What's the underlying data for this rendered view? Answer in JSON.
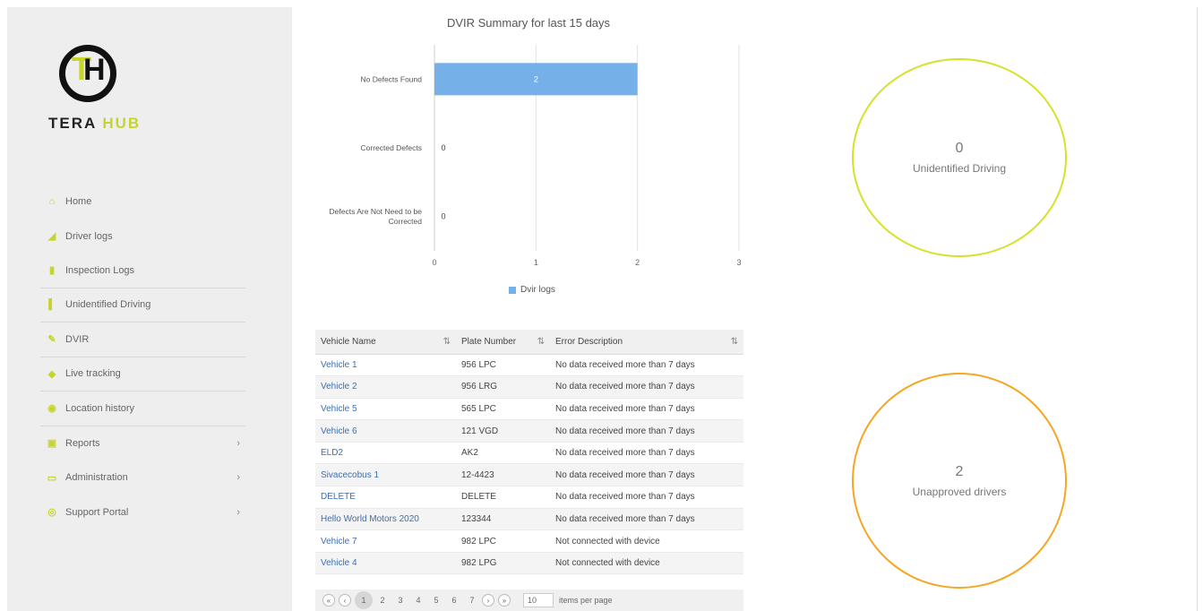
{
  "brand": {
    "name_part1": "TERA ",
    "name_part2": "HUB",
    "mark_t": "T",
    "mark_h": "H",
    "accent_color": "#c7d42d"
  },
  "sidebar": {
    "items": [
      {
        "label": "Home",
        "icon": "home-icon",
        "glyph": "⌂",
        "caret": ""
      },
      {
        "label": "Driver logs",
        "icon": "chart-icon",
        "glyph": "◢",
        "caret": ""
      },
      {
        "label": "Inspection Logs",
        "icon": "inspection-icon",
        "glyph": "▮",
        "caret": ""
      },
      {
        "label": "Unidentified Driving",
        "icon": "unidentified-icon",
        "glyph": "▌",
        "caret": ""
      },
      {
        "label": "DVIR",
        "icon": "wrench-icon",
        "glyph": "✎",
        "caret": ""
      },
      {
        "label": "Live tracking",
        "icon": "tracking-icon",
        "glyph": "◆",
        "caret": ""
      },
      {
        "label": "Location history",
        "icon": "history-icon",
        "glyph": "◉",
        "caret": ""
      },
      {
        "label": "Reports",
        "icon": "reports-icon",
        "glyph": "▣",
        "caret": "›"
      },
      {
        "label": "Administration",
        "icon": "admin-icon",
        "glyph": "▭",
        "caret": "›"
      },
      {
        "label": "Support Portal",
        "icon": "support-icon",
        "glyph": "◎",
        "caret": "›"
      }
    ]
  },
  "chart": {
    "title": "DVIR Summary for last 15 days",
    "legend": "Dvir logs"
  },
  "chart_data": {
    "type": "bar",
    "orientation": "horizontal",
    "title": "DVIR Summary for last 15 days",
    "categories": [
      "No Defects Found",
      "Corrected Defects",
      "Defects Are Not Need to be Corrected"
    ],
    "series": [
      {
        "name": "Dvir logs",
        "values": [
          2,
          0,
          0
        ],
        "color": "#76b0e8"
      }
    ],
    "xlim": [
      0,
      3
    ],
    "xticks": [
      "0",
      "1",
      "2",
      "3"
    ],
    "grid": "x"
  },
  "table": {
    "headers": [
      "Vehicle Name",
      "Plate Number",
      "Error Description"
    ],
    "rows": [
      [
        "Vehicle 1",
        "956 LPC",
        "No data received more than 7 days"
      ],
      [
        "Vehicle 2",
        "956 LRG",
        "No data received more than 7 days"
      ],
      [
        "Vehicle 5",
        "565 LPC",
        "No data received more than 7 days"
      ],
      [
        "Vehicle 6",
        "121 VGD",
        "No data received more than 7 days"
      ],
      [
        "ELD2",
        "AK2",
        "No data received more than 7 days"
      ],
      [
        "Sivacecobus 1",
        "12-4423",
        "No data received more than 7 days"
      ],
      [
        "DELETE",
        "DELETE",
        "No data received more than 7 days"
      ],
      [
        "Hello World Motors 2020",
        "123344",
        "No data received more than 7 days"
      ],
      [
        "Vehicle 7",
        "982 LPC",
        "Not connected with device"
      ],
      [
        "Vehicle 4",
        "982 LPG",
        "Not connected with device"
      ]
    ]
  },
  "pager": {
    "pages": [
      "1",
      "2",
      "3",
      "4",
      "5",
      "6",
      "7"
    ],
    "current": "1",
    "page_size": "10",
    "size_label": "items per page"
  },
  "stats": {
    "unidentified": {
      "value": "0",
      "label": "Unidentified Driving",
      "color": "#d6e22a"
    },
    "unapproved": {
      "value": "2",
      "label": "Unapproved drivers",
      "color": "#f5a623"
    }
  }
}
